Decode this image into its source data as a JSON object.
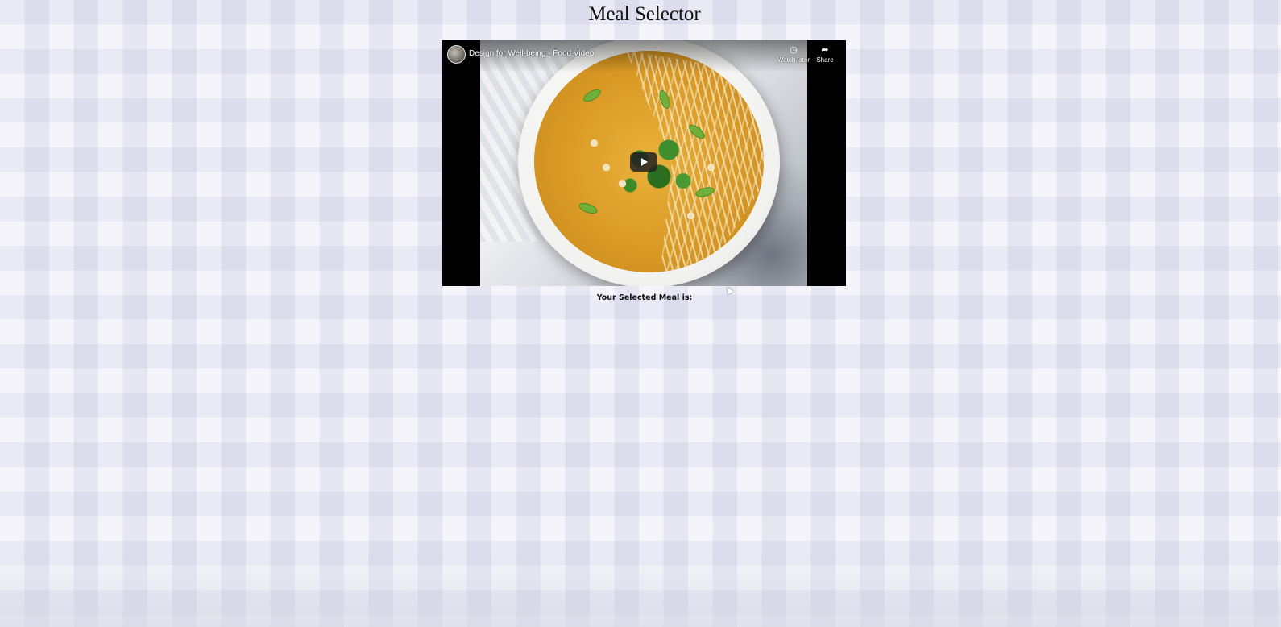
{
  "page": {
    "title": "Meal Selector",
    "selected_meal_label": "Your Selected Meal is:"
  },
  "video": {
    "title": "Design for Well-being - Food Video",
    "watch_later_label": "Watch later",
    "share_label": "Share",
    "channel_avatar": "channel-avatar",
    "play_icon": "play-icon"
  },
  "colors": {
    "background": "#e6e6f3",
    "video_letterbox": "#000000",
    "play_button_bg": "#212121"
  }
}
